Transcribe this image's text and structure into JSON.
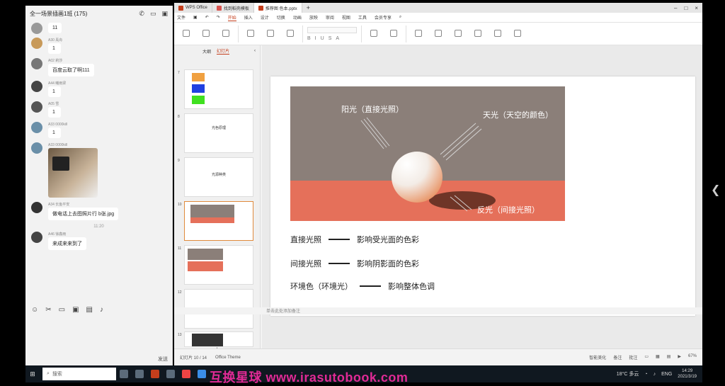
{
  "chat": {
    "title": "全一场景插画1班 (175)",
    "messages": [
      {
        "sender": "",
        "text": "11"
      },
      {
        "sender": "A30 禹舟",
        "text": "1"
      },
      {
        "sender": "A02 莉莎",
        "text": "百度云取了啊111"
      },
      {
        "sender": "A44 曦雨梁",
        "text": "1"
      },
      {
        "sender": "A05 雪",
        "text": "1"
      },
      {
        "sender": "A33 0000kill",
        "text": "1"
      },
      {
        "sender": "A33 0000kill",
        "text": ""
      },
      {
        "sender": "A34 长鱼平安",
        "text": "做电话上去图照片行 b张.jpg"
      },
      {
        "sender": "A46 徐鑫雨",
        "text": "来成来来到了"
      }
    ],
    "time": "11:20",
    "send_label": "发送"
  },
  "ppt": {
    "tabs": [
      {
        "label": "WPS Office"
      },
      {
        "label": "找到稻壳模板"
      },
      {
        "label": "推荐图 色本.pptx"
      }
    ],
    "menu": [
      "文件",
      "开始",
      "插入",
      "设计",
      "切换",
      "动画",
      "放映",
      "审阅",
      "视图",
      "工具",
      "会员专享"
    ],
    "active_menu": "开始",
    "pane_tabs": [
      "大纲",
      "幻灯片"
    ],
    "slide_numbers": [
      "7",
      "8",
      "9",
      "10",
      "11",
      "12",
      "13"
    ],
    "thumb_titles": {
      "s8": "光色原理",
      "s9": "光源种类"
    },
    "slide": {
      "label_sun": "阳光（直接光照）",
      "label_sky": "天光（天空的颜色）",
      "label_bounce": "反光（间接光照）",
      "rows": [
        {
          "left": "直接光照",
          "right": "影响受光面的色彩"
        },
        {
          "left": "间接光照",
          "right": "影响阴影面的色彩"
        },
        {
          "left": "环境色（环境光）",
          "right": "影响整体色调"
        }
      ]
    },
    "notes_placeholder": "单击此处添加备注",
    "status": {
      "slide_index": "幻灯片 10 / 14",
      "theme": "Office Theme",
      "smart_beauty": "智能美化",
      "notes": "备注",
      "comments": "批注",
      "zoom": "67%"
    }
  },
  "taskbar": {
    "search_placeholder": "搜索",
    "weather": "18°C 多云",
    "lang": "ENG",
    "time": "14:29",
    "date": "2021/3/19"
  },
  "watermark": "互换星球 www.irasutobook.com"
}
